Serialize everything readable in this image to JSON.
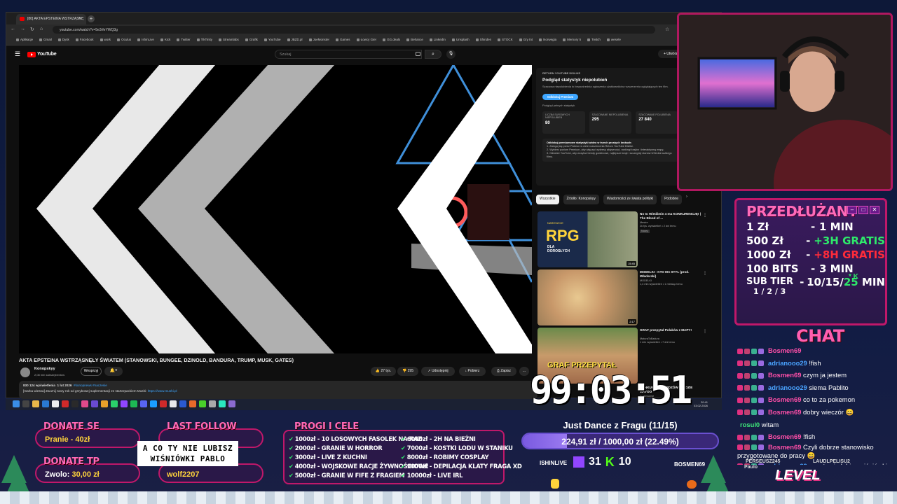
{
  "browser": {
    "tab_title": "[80] AKTA EPSTEINA WSTRZĄSNĘ",
    "url": "youtube.com/watch?v=5e3rfeYWQ3g",
    "bookmarks": [
      "Aplikacje",
      "Gmail",
      "Dysk",
      "Facebook",
      "work",
      "Oculus",
      "IshinLive",
      "Kick",
      "Twitter",
      "TikTinity",
      "Streamlabs",
      "Grafik",
      "YouTube",
      "JBZD.pl",
      "JoeMonster",
      "Games",
      "Łowcy Gier",
      "GG.deals",
      "Behance",
      "LinkedIn",
      "Unsplash",
      "Shinden",
      "STOCK",
      "Gry tnt",
      "Norwegia",
      "Memory 5",
      "Twitch",
      "wesele"
    ]
  },
  "youtube": {
    "logo_text": "YouTube",
    "search_placeholder": "Szukaj",
    "create_label": "+ Utwórz",
    "video_title": "AKTA EPSTEINA WSTRZĄSNĘŁY ŚWIATEM (STANOWSKI, BUNGEE, DZINOLD, BANDURA, TRUMP, MUSK, GATES)",
    "channel_name": "Konopskyy",
    "channel_subs": "2,08 mln subskrybentów",
    "support_label": "Wesprzyj",
    "actions": {
      "likes": "27 tys.",
      "dislikes": "295",
      "share": "Udostępnij",
      "download": "Pobierz",
      "save": "Zapisz",
      "more": "…"
    },
    "description": {
      "views": "830 124 wyświetlenia",
      "date": "1 lut 2026",
      "tags": "#konopnews #naczesie",
      "line2": "[marka wiesna] Zacznij nowy rok od grzybowej suplementacji ze starterpackiem Mushi:",
      "link": "https://www.mushi.pl"
    }
  },
  "ryd": {
    "kicker": "RETURN YOUTUBE DISLIKE",
    "heading": "Podgląd statystyk niepolubień",
    "text": "Szacowa niepolubienia to bezpośrednia zgłoszenia użytkowników rozszerzenia oglądających ten film.",
    "premium_btn": "Odblokuj Premium",
    "sub": "Podgląd pełnych statystyk",
    "stats": [
      {
        "label": "LICZBA SUROWYCH NIEPOLUBIEŃ",
        "value": "80"
      },
      {
        "label": "SZACOWANE NIEPOLUBIENIA",
        "value": "295"
      },
      {
        "label": "SZACOWANE POLUBIENIA",
        "value": "27 840"
      }
    ],
    "steps_title": "Odblokuj premiumowe statystyki wideo w trzech prostych krokach:",
    "steps": [
      "1. Zaloguj się przez Patreon w ciele rozszerzenia Return YouTube Dislike.",
      "2. Wybierz poziom Premium, aby włączyć wykresy aktywności, rankingi krajów i interaktywną mapę.",
      "3. Odśwież YouTube, aby wczytać trendy godzinowe, najlepsze kraje i szczegóły stanów USA dla każdego filmu."
    ]
  },
  "chips": [
    "Wszystkie",
    "Źródło: Konopskyy",
    "Wiadomości ze świata polityki",
    "Podobne"
  ],
  "recs": [
    {
      "title": "No to Wiedźmin 4 ma KONKURENCJĘ! | The Blood of ...",
      "channel": "Mestre",
      "meta": "2k tys. wyświetleń • 2 dni temu",
      "badge": "Nowy",
      "duration": "15:45",
      "thumb_text": "RPG",
      "thumb_sub": "DLA DOROSŁYCH",
      "thumb_top": "NARESZCIE"
    },
    {
      "title": "MODELKI - KTO MA STYL (prod. Władarski)",
      "channel": "MODELKI",
      "meta": "1,4 mln wyświetleń • 1 miesiąc temu",
      "duration": "2:17"
    },
    {
      "title": "GRAF przepytał Polaków z MAPY!",
      "channel": "MaturaToBzdura",
      "meta": "1 mln wyświetleń • 7 dni temu",
      "thumb_text": "GRAF PRZEPYTAŁ"
    },
    {
      "title": "KONKURS DLA WIDZÓW ZŁUDZIE WAYOO",
      "channel": "Pochmurnie",
      "meta": ""
    }
  ],
  "taskbar": {
    "time": "20:41",
    "date": "03.02.2026"
  },
  "przedluzany": {
    "title": "PRZEDŁUŻANY",
    "rows": [
      {
        "amount": "1 Zł",
        "sep": "-",
        "value": "1 MIN",
        "color": "white"
      },
      {
        "amount": "500 Zł",
        "sep": "-",
        "value": "+3H GRATIS",
        "color": "green"
      },
      {
        "amount": "1000 Zł",
        "sep": "-",
        "value": "+8H GRATIS",
        "color": "red"
      },
      {
        "amount": "100 BITS",
        "sep": "-",
        "value": "3 MIN",
        "color": "white"
      }
    ],
    "sub_tier": "SUB TIER",
    "sub_tier_levels": "1 / 2 / 3",
    "sub_tier_value": "10/15/",
    "sub_tier_value2": "25",
    "sub_tier_value3": " MIN",
    "k_mark": "* K"
  },
  "chat": {
    "title": "CHAT",
    "messages": [
      {
        "user": "Bosmen69",
        "text": "",
        "color": "pink"
      },
      {
        "user": "adrianooo29",
        "text": "!fish",
        "color": "blue"
      },
      {
        "user": "Bosmen69",
        "text": "czym ja jestem",
        "color": "pink"
      },
      {
        "user": "adrianooo29",
        "text": "siema Pablito",
        "color": "blue"
      },
      {
        "user": "Bosmen69",
        "text": "co to za pokemon",
        "color": "pink"
      },
      {
        "user": "Bosmen69",
        "text": "dobry wieczór 😄",
        "color": "pink"
      },
      {
        "user": "rosul0",
        "text": "witam",
        "color": "green"
      },
      {
        "user": "Bosmen69",
        "text": "!fish",
        "color": "pink"
      },
      {
        "user": "Bosmen69",
        "text": "Czyli dobrze stanowisko przygotowane do pracy 😄",
        "color": "pink"
      },
      {
        "user": "adrianooo29",
        "text": "a co ty nie lubisz wiśniówki",
        "color": "blue"
      }
    ]
  },
  "bottom": {
    "donate_se_label": "DONATE SE",
    "donate_se_value": "Pranie - 40zł",
    "donate_tp_label": "DONATE TP",
    "donate_tp_value_prefix": "Zwolo: ",
    "donate_tp_value": "30,00 zł",
    "last_follow_label": "LAST FOLLOW",
    "last_follow_value": "wolf2207",
    "popup": "A CO TY NIE LUBISZ WIŚNIÓWKI PABLO",
    "progi_title": "PROGI I CELE",
    "goals_left": [
      "1000zł - 10 LOSOWYCH FASOLEK NA RAZ",
      "2000zł - GRANIE W HORROR",
      "3000zł - LIVE Z KUCHNI",
      "4000zł - WOJSKOWE RACJE ŻYWNOŚCIOWE",
      "5000zł - GRANIE W FIFE Z FRAGIEM"
    ],
    "goals_right": [
      "6000zł - 2H NA BIEŻNI",
      "7000zł - KOSTKI LODU W STANIKU",
      "8000zł - ROBIMY COSPLAY",
      "9000zł - DEPILACJA KLATY FRAGA XD",
      "10000zł - LIVE IRL"
    ],
    "subath_title": "Just Dance z Fragu (11/15)",
    "subath_progress": "224,91 zł / 1000,00 zł (22.49%)",
    "subath_fraction": 0.2249,
    "platform_left": "ISHINLIVE",
    "twitch_count": "31",
    "kick_count": "10",
    "platform_right": "BOSMEN69",
    "timer": "99:03:51",
    "level_text": "LEVEL",
    "bottom_names": [
      "PERSEUSZ245",
      "LAUDLPELISU2",
      "Paulo"
    ]
  }
}
